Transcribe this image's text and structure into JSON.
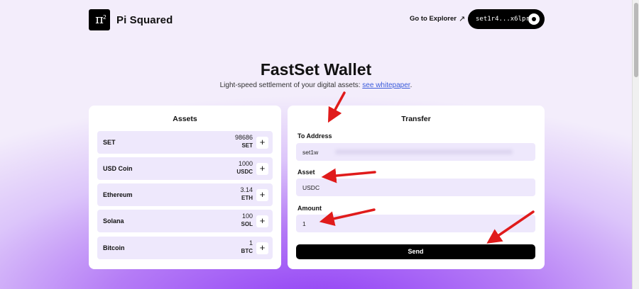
{
  "header": {
    "logo_mark": "π",
    "logo_mark_sup": "2",
    "brand": "Pi Squared",
    "explorer_link": "Go to Explorer",
    "wallet_address": "set1r4...x6lprc"
  },
  "hero": {
    "title": "FastSet Wallet",
    "subtitle_text": "Light-speed settlement of your digital assets: ",
    "subtitle_link": "see whitepaper",
    "subtitle_end": "."
  },
  "assets": {
    "title": "Assets",
    "items": [
      {
        "name": "SET",
        "amount": "98686",
        "symbol": "SET"
      },
      {
        "name": "USD Coin",
        "amount": "1000",
        "symbol": "USDC"
      },
      {
        "name": "Ethereum",
        "amount": "3.14",
        "symbol": "ETH"
      },
      {
        "name": "Solana",
        "amount": "100",
        "symbol": "SOL"
      },
      {
        "name": "Bitcoin",
        "amount": "1",
        "symbol": "BTC"
      }
    ],
    "add_label": "+"
  },
  "transfer": {
    "title": "Transfer",
    "to_label": "To Address",
    "to_value_prefix": "set1w",
    "asset_label": "Asset",
    "asset_value": "USDC",
    "amount_label": "Amount",
    "amount_value": "1",
    "send_label": "Send"
  },
  "colors": {
    "accent": "#9b4dff",
    "annotation_arrow": "#e01b1b",
    "field_bg": "#eee8fc"
  }
}
